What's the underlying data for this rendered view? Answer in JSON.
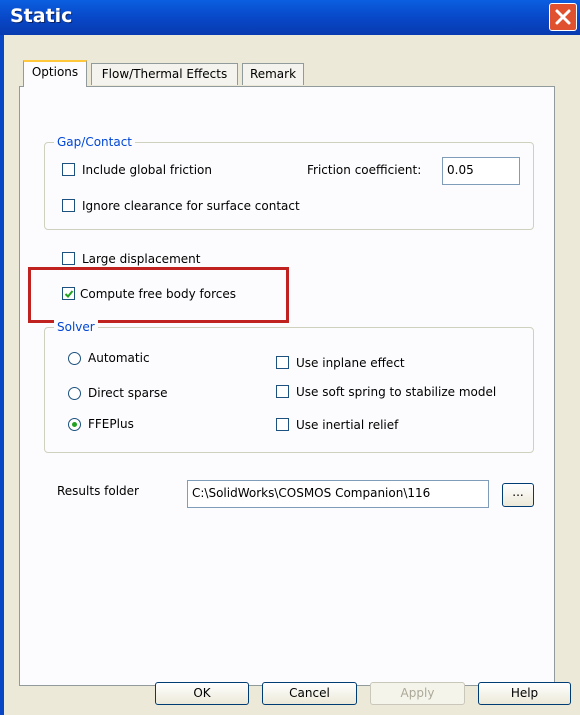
{
  "window": {
    "title": "Static"
  },
  "tabs": [
    {
      "label": "Options"
    },
    {
      "label": "Flow/Thermal Effects"
    },
    {
      "label": "Remark"
    }
  ],
  "gap_contact": {
    "legend": "Gap/Contact",
    "include_global_friction": "Include global friction",
    "friction_coefficient_label": "Friction coefficient:",
    "friction_coefficient_value": "0.05",
    "ignore_clearance": "Ignore clearance for surface contact"
  },
  "large_displacement": "Large displacement",
  "compute_free_body_forces": "Compute free body forces",
  "solver": {
    "legend": "Solver",
    "automatic": "Automatic",
    "direct_sparse": "Direct sparse",
    "ffeplus": "FFEPlus",
    "selected": "FFEPlus",
    "use_inplane_effect": "Use inplane effect",
    "use_soft_spring": "Use soft spring to stabilize model",
    "use_inertial_relief": "Use inertial relief"
  },
  "results_folder": {
    "label": "Results folder",
    "value": "C:\\SolidWorks\\COSMOS Companion\\116",
    "browse_label": "..."
  },
  "buttons": {
    "ok": "OK",
    "cancel": "Cancel",
    "apply": "Apply",
    "help": "Help"
  },
  "colors": {
    "titlebar": "#0846c6",
    "highlight": "#c0221f",
    "legend_text": "#0046d5"
  }
}
